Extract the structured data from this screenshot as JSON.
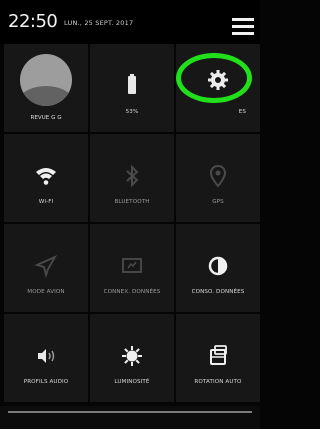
{
  "status": {
    "time": "22:50",
    "date": "LUN., 25 SEPT. 2017"
  },
  "tiles": {
    "profile": {
      "label": "REVUE G G"
    },
    "battery": {
      "label": "53%"
    },
    "settings": {
      "label": "ES"
    },
    "wifi": {
      "label": "WI-FI"
    },
    "bluetooth": {
      "label": "BLUETOOTH"
    },
    "gps": {
      "label": "GPS"
    },
    "airplane": {
      "label": "MODE AVION"
    },
    "data": {
      "label": "CONNEX. DONNÉES"
    },
    "usage": {
      "label": "CONSO. DONNÉES"
    },
    "audio": {
      "label": "PROFILS AUDIO"
    },
    "brightness": {
      "label": "LUMINOSITÉ"
    },
    "rotation": {
      "label": "ROTATION AUTO"
    }
  },
  "colors": {
    "highlight": "#21e01b",
    "tile": "#171717",
    "background": "#050505"
  },
  "icons": {
    "settings": "gear-icon",
    "battery": "battery-icon",
    "wifi": "wifi-icon",
    "bluetooth": "bluetooth-icon",
    "gps": "location-pin-icon",
    "airplane": "airplane-icon",
    "data": "data-connection-icon",
    "usage": "data-usage-icon",
    "audio": "audio-profile-icon",
    "brightness": "brightness-icon",
    "rotation": "auto-rotate-icon",
    "menu": "menu-icon"
  }
}
